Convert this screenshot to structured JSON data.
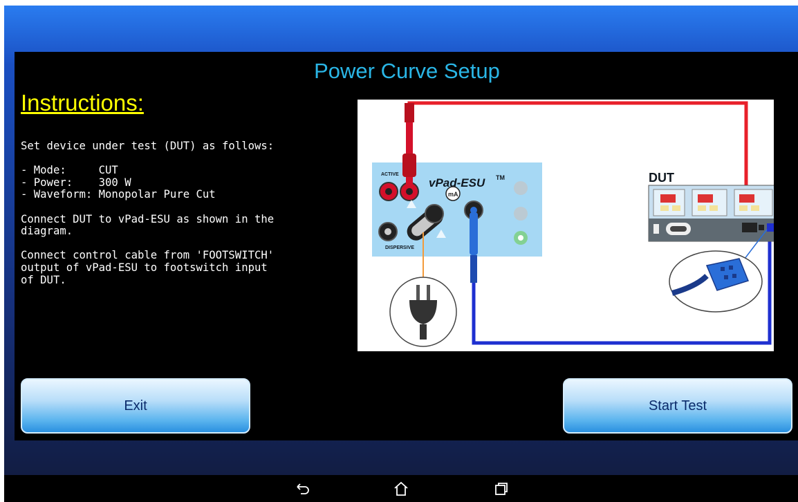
{
  "screen": {
    "title": "Power Curve Setup"
  },
  "instructions": {
    "heading": "Instructions:",
    "body": "Set device under test (DUT) as follows:\n\n- Mode:     CUT\n- Power:    300 W\n- Waveform: Monopolar Pure Cut\n\nConnect DUT to vPad-ESU as shown in the\ndiagram.\n\nConnect control cable from 'FOOTSWITCH'\noutput of vPad-ESU to footswitch input\nof DUT."
  },
  "diagram": {
    "device_name": "vPad-ESU",
    "trademark": "TM",
    "active_label": "ACTIVE",
    "dispersive_label": "DISPERSIVE",
    "ma_label": "mA",
    "dut_label": "DUT",
    "colors": {
      "red_lead": "#e8202a",
      "blue_lead": "#1e2fd0",
      "orange_lead": "#f39a3a",
      "cable_blue": "#2a6ed8"
    }
  },
  "buttons": {
    "exit": "Exit",
    "start_test": "Start Test"
  },
  "navbar": {
    "icons": [
      "back-icon",
      "home-icon",
      "recent-apps-icon"
    ]
  }
}
